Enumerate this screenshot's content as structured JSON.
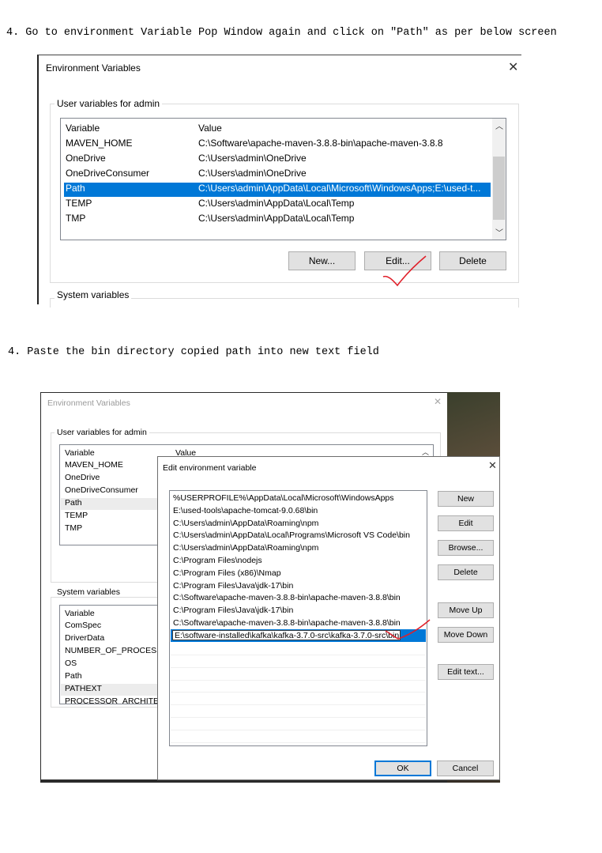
{
  "step1": {
    "text": "4. Go to environment Variable Pop Window again and click on \"Path\" as per below screen"
  },
  "step2": {
    "text": "4. Paste the bin directory copied path into new text field"
  },
  "shot1": {
    "title": "Environment Variables",
    "user_group": "User variables for admin",
    "col_variable": "Variable",
    "col_value": "Value",
    "rows": [
      {
        "variable": "MAVEN_HOME",
        "value": "C:\\Software\\apache-maven-3.8.8-bin\\apache-maven-3.8.8"
      },
      {
        "variable": "OneDrive",
        "value": "C:\\Users\\admin\\OneDrive"
      },
      {
        "variable": "OneDriveConsumer",
        "value": "C:\\Users\\admin\\OneDrive"
      },
      {
        "variable": "Path",
        "value": "C:\\Users\\admin\\AppData\\Local\\Microsoft\\WindowsApps;E:\\used-t..."
      },
      {
        "variable": "TEMP",
        "value": "C:\\Users\\admin\\AppData\\Local\\Temp"
      },
      {
        "variable": "TMP",
        "value": "C:\\Users\\admin\\AppData\\Local\\Temp"
      }
    ],
    "btn_new": "New...",
    "btn_edit": "Edit...",
    "btn_delete": "Delete",
    "system_group": "System variables"
  },
  "shot2": {
    "title": "Environment Variables",
    "user_group": "User variables for admin",
    "col_variable": "Variable",
    "col_value": "Value",
    "user_rows": [
      "MAVEN_HOME",
      "OneDrive",
      "OneDriveConsumer",
      "Path",
      "TEMP",
      "TMP"
    ],
    "system_group": "System variables",
    "sys_col_variable": "Variable",
    "sys_rows": [
      "ComSpec",
      "DriverData",
      "NUMBER_OF_PROCESSORS",
      "OS",
      "Path",
      "PATHEXT",
      "PROCESSOR_ARCHITECTURE"
    ],
    "dialog": {
      "title": "Edit environment variable",
      "entries": [
        "%USERPROFILE%\\AppData\\Local\\Microsoft\\WindowsApps",
        "E:\\used-tools\\apache-tomcat-9.0.68\\bin",
        "C:\\Users\\admin\\AppData\\Roaming\\npm",
        "C:\\Users\\admin\\AppData\\Local\\Programs\\Microsoft VS Code\\bin",
        "C:\\Users\\admin\\AppData\\Roaming\\npm",
        "C:\\Program Files\\nodejs",
        "C:\\Program Files (x86)\\Nmap",
        "C:\\Program Files\\Java\\jdk-17\\bin",
        "C:\\Software\\apache-maven-3.8.8-bin\\apache-maven-3.8.8\\bin",
        "C:\\Program Files\\Java\\jdk-17\\bin",
        "C:\\Software\\apache-maven-3.8.8-bin\\apache-maven-3.8.8\\bin"
      ],
      "editing_value": "E:\\software-installed\\kafka\\kafka-3.7.0-src\\kafka-3.7.0-src\\bin",
      "btn_new": "New",
      "btn_edit": "Edit",
      "btn_browse": "Browse...",
      "btn_delete": "Delete",
      "btn_move_up": "Move Up",
      "btn_move_down": "Move Down",
      "btn_edit_text": "Edit text...",
      "btn_ok": "OK",
      "btn_cancel": "Cancel"
    }
  },
  "colors": {
    "selection": "#0078d7",
    "annotation": "#e0202a"
  },
  "icons": {
    "close": "close-icon",
    "scroll_up": "chevron-up-icon",
    "scroll_down": "chevron-down-icon"
  }
}
